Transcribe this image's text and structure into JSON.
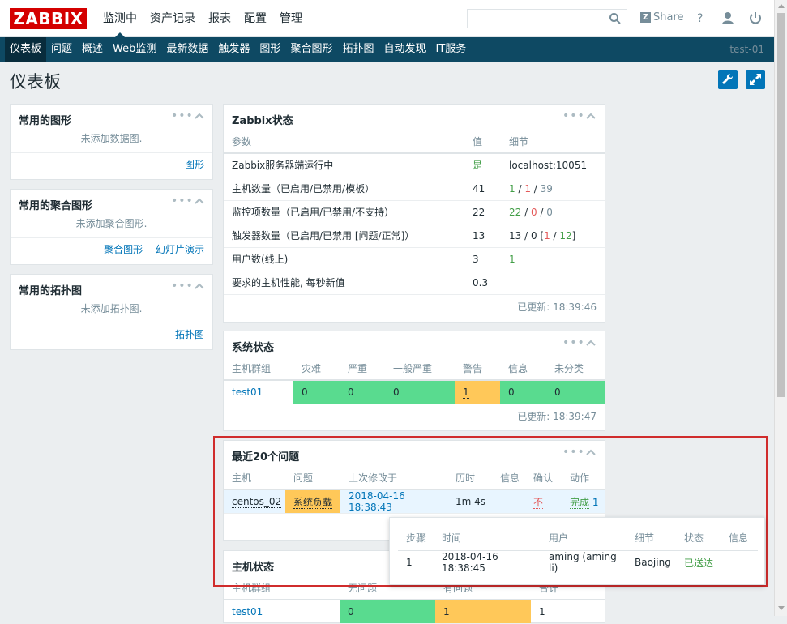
{
  "logo": "ZABBIX",
  "top_nav": [
    {
      "label": "监测中",
      "active": true
    },
    {
      "label": "资产记录"
    },
    {
      "label": "报表"
    },
    {
      "label": "配置"
    },
    {
      "label": "管理"
    }
  ],
  "share_label": "Share",
  "sub_nav": [
    "仪表板",
    "问题",
    "概述",
    "Web监测",
    "最新数据",
    "触发器",
    "图形",
    "聚合图形",
    "拓扑图",
    "自动发现",
    "IT服务"
  ],
  "sub_nav_right": "test-01",
  "page_title": "仪表板",
  "fav_graphs": {
    "title": "常用的图形",
    "empty": "未添加数据图.",
    "link": "图形"
  },
  "fav_screens": {
    "title": "常用的聚合图形",
    "empty": "未添加聚合图形.",
    "link1": "聚合图形",
    "link2": "幻灯片演示"
  },
  "fav_maps": {
    "title": "常用的拓扑图",
    "empty": "未添加拓扑图.",
    "link": "拓扑图"
  },
  "zabbix_status": {
    "title": "Zabbix状态",
    "headers": [
      "参数",
      "值",
      "细节"
    ],
    "rows": [
      {
        "param": "Zabbix服务器端运行中",
        "value": "是",
        "d1": "localhost:10051"
      },
      {
        "param": "主机数量（已启用/已禁用/模板）",
        "value": "41",
        "d1": "1",
        "s1": " / ",
        "d2": "1",
        "s2": " / ",
        "d3": "39"
      },
      {
        "param": "监控项数量（已启用/已禁用/不支持）",
        "value": "22",
        "d1": "22",
        "s1": " / ",
        "d2": "0",
        "s2": " / ",
        "d3": "0"
      },
      {
        "param": "触发器数量（已启用/已禁用 [问题/正常]）",
        "value": "13",
        "d1": "13 / 0 [",
        "d2": "1",
        "s2": " / ",
        "d3": "12",
        "s3": "]"
      },
      {
        "param": "用户数(线上)",
        "value": "3",
        "d1": "1"
      },
      {
        "param": "要求的主机性能, 每秒新值",
        "value": "0.3",
        "d1": ""
      }
    ],
    "updated": "已更新: 18:39:46"
  },
  "system_status": {
    "title": "系统状态",
    "headers": [
      "主机群组",
      "灾难",
      "严重",
      "一般严重",
      "警告",
      "信息",
      "未分类"
    ],
    "row": {
      "group": "test01",
      "vals": [
        "0",
        "0",
        "0",
        "1",
        "0",
        "0"
      ]
    },
    "updated": "已更新: 18:39:47"
  },
  "last_issues": {
    "title": "最近20个问题",
    "headers": [
      "主机",
      "问题",
      "上次修改于",
      "历时",
      "信息",
      "确认",
      "动作"
    ],
    "row": {
      "host": "centos_02",
      "problem": "系统负载",
      "time": "2018-04-16 18:38:43",
      "duration": "1m 4s",
      "info": "",
      "ack": "不",
      "action": "完成",
      "action_count": "1"
    }
  },
  "host_status": {
    "title": "主机状态",
    "headers": [
      "主机群组",
      "无问题",
      "有问题",
      "合计"
    ],
    "row": {
      "group": "test01",
      "ok": "0",
      "problem": "1",
      "total": "1"
    }
  },
  "popup": {
    "headers": [
      "步骤",
      "时间",
      "用户",
      "细节",
      "状态",
      "信息"
    ],
    "row": {
      "step": "1",
      "time": "2018-04-16 18:38:45",
      "user": "aming (aming li)",
      "detail": "Baojing",
      "status": "已送达",
      "info": ""
    }
  },
  "colors": {
    "accent": "#0e4963",
    "ok": "#59db8f",
    "warning": "#ffc859",
    "logo": "#d40000",
    "highlight": "#d02c2c"
  }
}
